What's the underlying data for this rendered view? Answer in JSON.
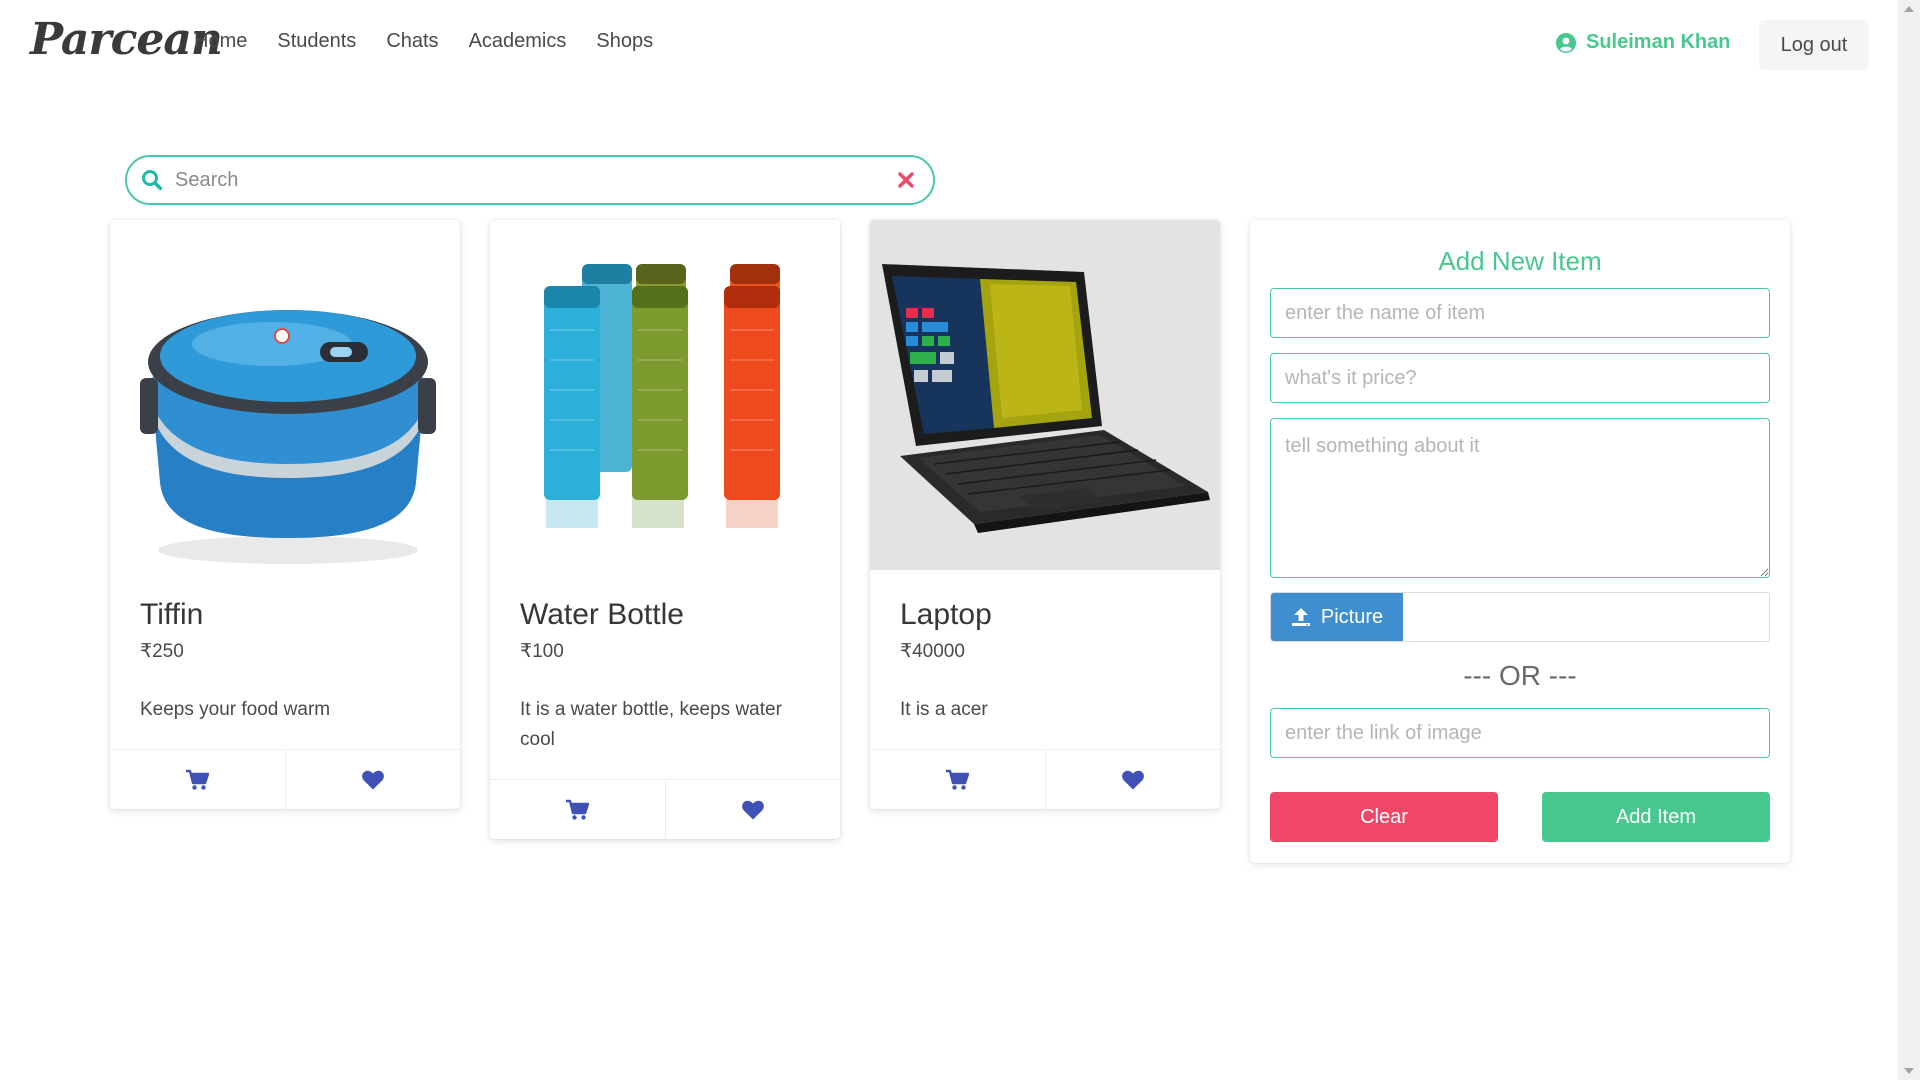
{
  "navbar": {
    "brand": "Parcean",
    "links": [
      "Home",
      "Students",
      "Chats",
      "Academics",
      "Shops"
    ],
    "user_name": "Suleiman Khan",
    "logout_label": "Log out"
  },
  "search": {
    "placeholder": "Search"
  },
  "products": [
    {
      "name": "Tiffin",
      "price": "₹250",
      "description": "Keeps your food warm",
      "image": "blue lunch box"
    },
    {
      "name": "Water Bottle",
      "price": "₹100",
      "description": "It is a water bottle, keeps water cool",
      "image": "colored bottles"
    },
    {
      "name": "Laptop",
      "price": "₹40000",
      "description": "It is a acer",
      "image": "acer laptop"
    }
  ],
  "add_item_form": {
    "title": "Add New Item",
    "name_placeholder": "enter the name of item",
    "price_placeholder": "what's it price?",
    "description_placeholder": "tell something about it",
    "picture_label": "Picture",
    "separator": "--- OR ---",
    "link_placeholder": "enter the link of image",
    "clear_label": "Clear",
    "add_label": "Add Item"
  },
  "colors": {
    "accent": "#48c78e",
    "danger": "#f14668",
    "info": "#3e8ed0",
    "icon_blue": "#3f51b5",
    "border_teal": "#48c7b0"
  }
}
